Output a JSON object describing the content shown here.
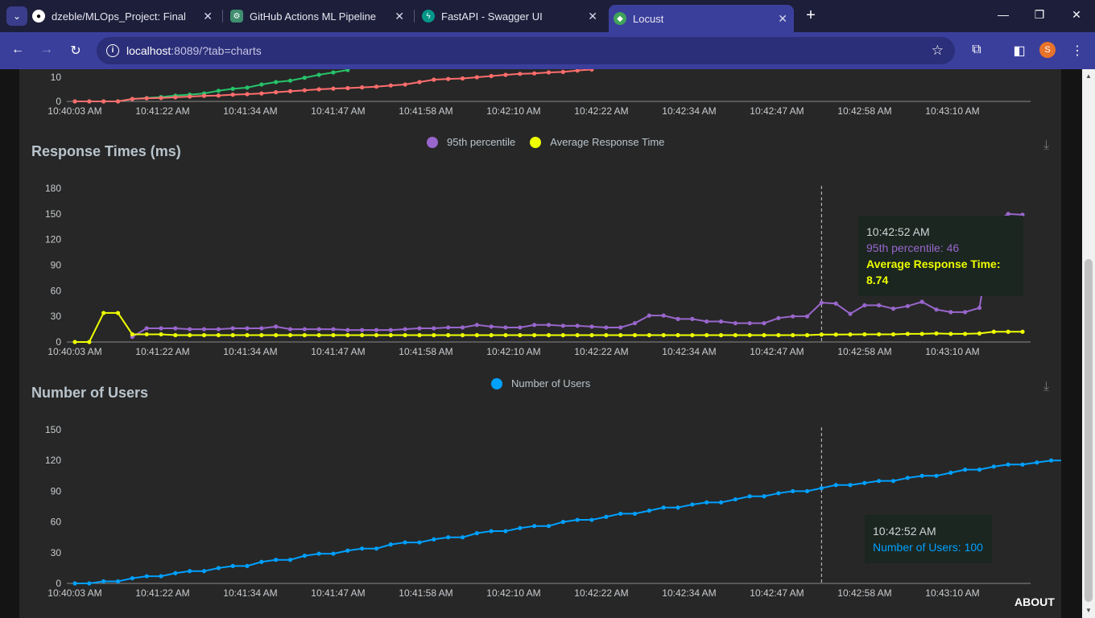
{
  "browser": {
    "tabs": [
      {
        "title": "dzeble/MLOps_Project: Final Pro",
        "icon": "github-icon",
        "active": false
      },
      {
        "title": "GitHub Actions ML Pipeline",
        "icon": "chatgpt-icon",
        "active": false
      },
      {
        "title": "FastAPI - Swagger UI",
        "icon": "fastapi-icon",
        "active": false
      },
      {
        "title": "Locust",
        "icon": "locust-icon",
        "active": true
      }
    ],
    "url_host": "localhost",
    "url_rest": ":8089/?tab=charts",
    "profile_initial": "S"
  },
  "colors": {
    "green": "#27c36a",
    "red": "#ff6d6d",
    "purple": "#9966cc",
    "yellow": "#eeff00",
    "blue": "#00a0ff",
    "tooltip_bg": "#1b2620"
  },
  "time_labels": [
    "10:40:03 AM",
    "10:41:22 AM",
    "10:41:34 AM",
    "10:41:47 AM",
    "10:41:58 AM",
    "10:42:10 AM",
    "10:42:22 AM",
    "10:42:34 AM",
    "10:42:47 AM",
    "10:42:58 AM",
    "10:43:10 AM"
  ],
  "response_times": {
    "title": "Response Times (ms)",
    "legend": [
      "95th percentile",
      "Average Response Time"
    ],
    "tooltip": {
      "time": "10:42:52 AM",
      "p95": "95th percentile: 46",
      "avg": "Average Response Time: 8.74"
    }
  },
  "users": {
    "title": "Number of Users",
    "legend": [
      "Number of Users"
    ],
    "tooltip": {
      "time": "10:42:52 AM",
      "users": "Number of Users: 100"
    }
  },
  "footer": {
    "about": "ABOUT"
  },
  "chart_data": [
    {
      "type": "line",
      "title": "",
      "partial": true,
      "note_series": "top chart partially scrolled out of view",
      "y_ticks": [
        0,
        10
      ],
      "series": [
        {
          "color": "#27c36a",
          "values": [
            0,
            0,
            0,
            0,
            1,
            1.4,
            1.8,
            2.4,
            2.8,
            3.3,
            4.4,
            5.2,
            5.7,
            7,
            8,
            8.6,
            9.8,
            11,
            12,
            13,
            14,
            15,
            16
          ]
        },
        {
          "color": "#ff6d6d",
          "values": [
            0,
            0,
            0,
            0,
            1,
            1.3,
            1.4,
            1.7,
            2,
            2.3,
            2.4,
            2.8,
            3,
            3.3,
            3.8,
            4.2,
            4.6,
            5,
            5.3,
            5.5,
            5.8,
            6.1,
            6.6,
            7,
            8,
            9,
            9.3,
            9.5,
            10,
            10.5,
            11,
            11.4,
            11.6,
            12,
            12.2,
            12.8,
            13.2,
            13.6,
            14
          ]
        }
      ]
    },
    {
      "type": "line",
      "title": "Response Times (ms)",
      "y_ticks": [
        0,
        30,
        60,
        90,
        120,
        150,
        180
      ],
      "ylim": [
        0,
        180
      ],
      "series": [
        {
          "name": "95th percentile",
          "color": "#9966cc",
          "start_index": 4,
          "values": [
            6,
            16,
            16,
            16,
            15,
            15,
            15,
            16,
            16,
            16,
            18,
            15,
            15,
            15,
            15,
            14,
            14,
            14,
            14,
            15,
            16,
            16,
            17,
            17,
            20,
            18,
            17,
            17,
            20,
            20,
            19,
            19,
            18,
            17,
            17,
            22,
            31,
            31,
            27,
            27,
            24,
            24,
            22,
            22,
            22,
            28,
            30,
            30,
            46,
            45,
            33,
            43,
            43,
            39,
            42,
            47,
            38,
            35,
            35,
            40,
            140,
            150,
            149
          ]
        },
        {
          "name": "Average Response Time",
          "color": "#eeff00",
          "values": [
            0,
            0,
            34,
            34,
            9,
            9,
            9,
            8,
            8,
            8,
            8,
            8,
            8,
            8,
            8,
            8,
            8,
            8,
            8,
            8,
            8,
            8,
            8,
            8,
            8,
            8,
            8,
            8,
            8,
            8,
            8,
            8,
            8,
            8,
            8,
            8,
            8,
            8,
            8,
            8,
            8,
            8,
            8,
            8,
            8,
            8,
            8,
            8,
            8,
            8,
            8,
            8,
            8.74,
            8.74,
            8.8,
            9,
            9,
            9,
            9.5,
            9.5,
            10,
            9.5,
            9.5,
            10,
            12,
            12,
            12
          ]
        }
      ]
    },
    {
      "type": "line",
      "title": "Number of Users",
      "y_ticks": [
        0,
        30,
        60,
        90,
        120,
        150
      ],
      "ylim": [
        0,
        150
      ],
      "series": [
        {
          "name": "Number of Users",
          "color": "#00a0ff",
          "values": [
            0,
            0,
            2,
            2,
            5,
            7,
            7,
            10,
            12,
            12,
            15,
            17,
            17,
            21,
            23,
            23,
            27,
            29,
            29,
            32,
            34,
            34,
            38,
            40,
            40,
            43,
            45,
            45,
            49,
            51,
            51,
            54,
            56,
            56,
            60,
            62,
            62,
            65,
            68,
            68,
            71,
            74,
            74,
            77,
            79,
            79,
            82,
            85,
            85,
            88,
            90,
            90,
            93,
            96,
            96,
            98,
            100,
            100,
            103,
            105,
            105,
            108,
            111,
            111,
            114,
            116,
            116,
            118,
            120,
            120,
            122,
            124,
            125
          ]
        }
      ]
    }
  ]
}
